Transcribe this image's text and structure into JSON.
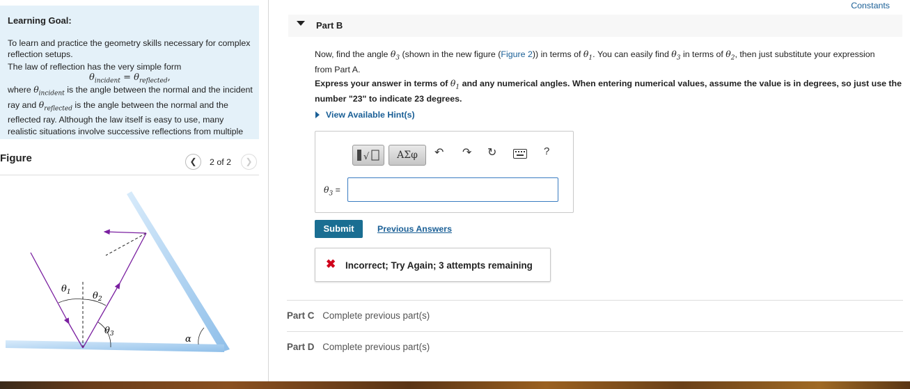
{
  "constants_link": "Constants",
  "learning_goal": {
    "title": "Learning Goal:",
    "intro": "To learn and practice the geometry skills necessary for complex reflection setups.",
    "law_text": "The law of reflection has the very simple form",
    "eq_lhs": "θ",
    "eq_lhs_sub": "incident",
    "eq_rhs": "θ",
    "eq_rhs_sub": "reflected",
    "where_1": "where",
    "where_theta": "θ",
    "where_sub_incident": "incident",
    "where_2": "is the angle between the normal and the incident ray and",
    "where_sub_reflected": "reflected",
    "where_3": "is the angle between the normal and the reflected ray. Although the law itself is easy to use, many realistic situations involve successive reflections from multiple surfaces. The law of reflection does not become"
  },
  "figure": {
    "title": "Figure",
    "counter": "2 of 2",
    "prev_icon": "chevron-left-icon",
    "next_icon": "chevron-right-icon",
    "labels": {
      "theta1": "θ",
      "theta1_sub": "1",
      "theta2": "θ",
      "theta2_sub": "2",
      "theta3": "θ",
      "theta3_sub": "3",
      "alpha": "α"
    }
  },
  "part_b": {
    "title": "Part B",
    "question_a": "Now, find the angle",
    "question_b": "(shown in the new figure (",
    "figure_link": "Figure 2",
    "question_c": ")) in terms of",
    "question_d": ". You can easily find",
    "question_e": "in terms of",
    "question_f": ", then just substitute your expression from Part A.",
    "instruction_a": "Express your answer in terms of",
    "instruction_b": "and any numerical angles. When entering numerical values, assume the value is in degrees, so just use the number \"23\" to indicate 23 degrees.",
    "hint_label": "View Available Hint(s)",
    "toolbar": {
      "greek": "ΑΣφ",
      "undo_icon": "undo-icon",
      "redo_icon": "redo-icon",
      "reset_icon": "reset-icon",
      "keyboard_icon": "keyboard-icon",
      "help": "?"
    },
    "answer_label": "θ₃ =",
    "answer_value": "",
    "submit_label": "Submit",
    "previous_answers": "Previous Answers",
    "feedback": "Incorrect; Try Again; 3 attempts remaining",
    "feedback_icon": "x-icon"
  },
  "parts": [
    {
      "label": "Part C",
      "status": "Complete previous part(s)"
    },
    {
      "label": "Part D",
      "status": "Complete previous part(s)"
    }
  ],
  "colors": {
    "goal_bg": "#e4f1f9",
    "link": "#1a5f96",
    "submit_bg": "#1a6e92",
    "error": "#d0021b",
    "ray": "#7a1fa0",
    "mirror": "#a9d0f2"
  }
}
